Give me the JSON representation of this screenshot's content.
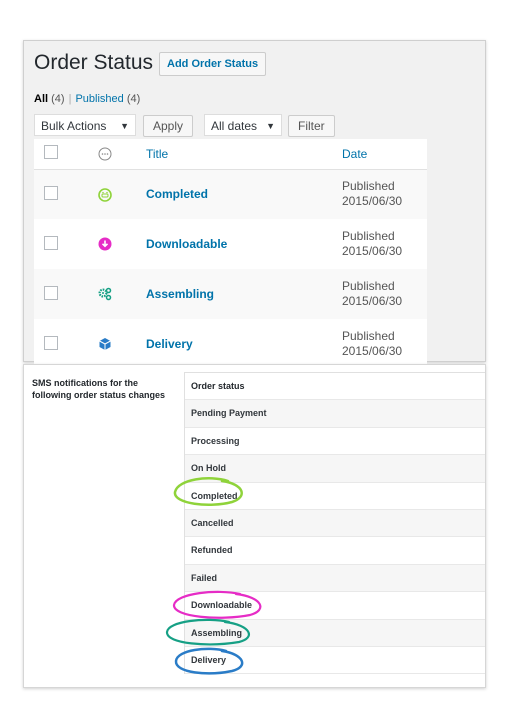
{
  "header": {
    "title": "Order Status",
    "add_button": "Add Order Status"
  },
  "filters": {
    "all_label": "All",
    "all_count": "(4)",
    "separator": "|",
    "published_label": "Published",
    "published_count": "(4)"
  },
  "toolbar": {
    "bulk_actions": "Bulk Actions",
    "apply": "Apply",
    "all_dates": "All dates",
    "filter": "Filter"
  },
  "table": {
    "columns": [
      "Title",
      "Date"
    ],
    "rows": [
      {
        "title": "Completed",
        "status": "Published",
        "date": "2015/06/30",
        "icon": "smiley-icon",
        "icon_color": "#8fd33a"
      },
      {
        "title": "Downloadable",
        "status": "Published",
        "date": "2015/06/30",
        "icon": "download-icon",
        "icon_color": "#e62cc6"
      },
      {
        "title": "Assembling",
        "status": "Published",
        "date": "2015/06/30",
        "icon": "gears-icon",
        "icon_color": "#16a085"
      },
      {
        "title": "Delivery",
        "status": "Published",
        "date": "2015/06/30",
        "icon": "box-icon",
        "icon_color": "#2a7cc7"
      }
    ]
  },
  "sms": {
    "label": "SMS notifications for the following order status changes",
    "header": "Order status",
    "statuses": [
      "Pending Payment",
      "Processing",
      "On Hold",
      "Completed",
      "Cancelled",
      "Refunded",
      "Failed",
      "Downloadable",
      "Assembling",
      "Delivery"
    ]
  },
  "colors": {
    "link": "#0073aa",
    "completed": "#8fd33a",
    "downloadable": "#e62cc6",
    "assembling": "#16a085",
    "delivery": "#2a7cc7"
  }
}
